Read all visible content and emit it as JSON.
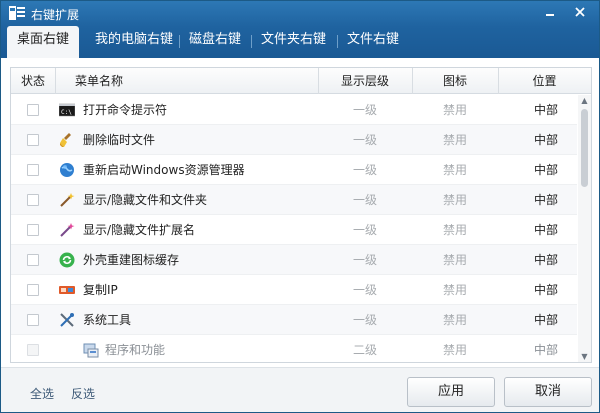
{
  "window": {
    "title": "右键扩展"
  },
  "tabs": [
    {
      "label": "桌面右键",
      "active": true
    },
    {
      "label": "我的电脑右键",
      "active": false
    },
    {
      "label": "磁盘右键",
      "active": false
    },
    {
      "label": "文件夹右键",
      "active": false
    },
    {
      "label": "文件右键",
      "active": false
    }
  ],
  "table": {
    "columns": [
      "状态",
      "菜单名称",
      "显示层级",
      "图标",
      "位置"
    ],
    "rows": [
      {
        "icon": "cmd-icon",
        "name": "打开命令提示符",
        "level": "一级",
        "icon_status": "禁用",
        "position": "中部"
      },
      {
        "icon": "broom-icon",
        "name": "删除临时文件",
        "level": "一级",
        "icon_status": "禁用",
        "position": "中部"
      },
      {
        "icon": "globe-icon",
        "name": "重新启动Windows资源管理器",
        "level": "一级",
        "icon_status": "禁用",
        "position": "中部"
      },
      {
        "icon": "magic-wand-icon",
        "name": "显示/隐藏文件和文件夹",
        "level": "一级",
        "icon_status": "禁用",
        "position": "中部"
      },
      {
        "icon": "magic-wand-pink-icon",
        "name": "显示/隐藏文件扩展名",
        "level": "一级",
        "icon_status": "禁用",
        "position": "中部"
      },
      {
        "icon": "refresh-icon",
        "name": "外壳重建图标缓存",
        "level": "一级",
        "icon_status": "禁用",
        "position": "中部"
      },
      {
        "icon": "copy-ip-icon",
        "name": "复制IP",
        "level": "一级",
        "icon_status": "禁用",
        "position": "中部"
      },
      {
        "icon": "tools-icon",
        "name": "系统工具",
        "level": "一级",
        "icon_status": "禁用",
        "position": "中部"
      },
      {
        "icon": "programs-icon",
        "name": "程序和功能",
        "level": "二级",
        "icon_status": "禁用",
        "position": "中部"
      }
    ]
  },
  "footer": {
    "select_all": "全选",
    "invert": "反选",
    "apply": "应用",
    "cancel": "取消"
  },
  "colors": {
    "title_bar": "#1f63a0",
    "border": "#1c5a86"
  }
}
